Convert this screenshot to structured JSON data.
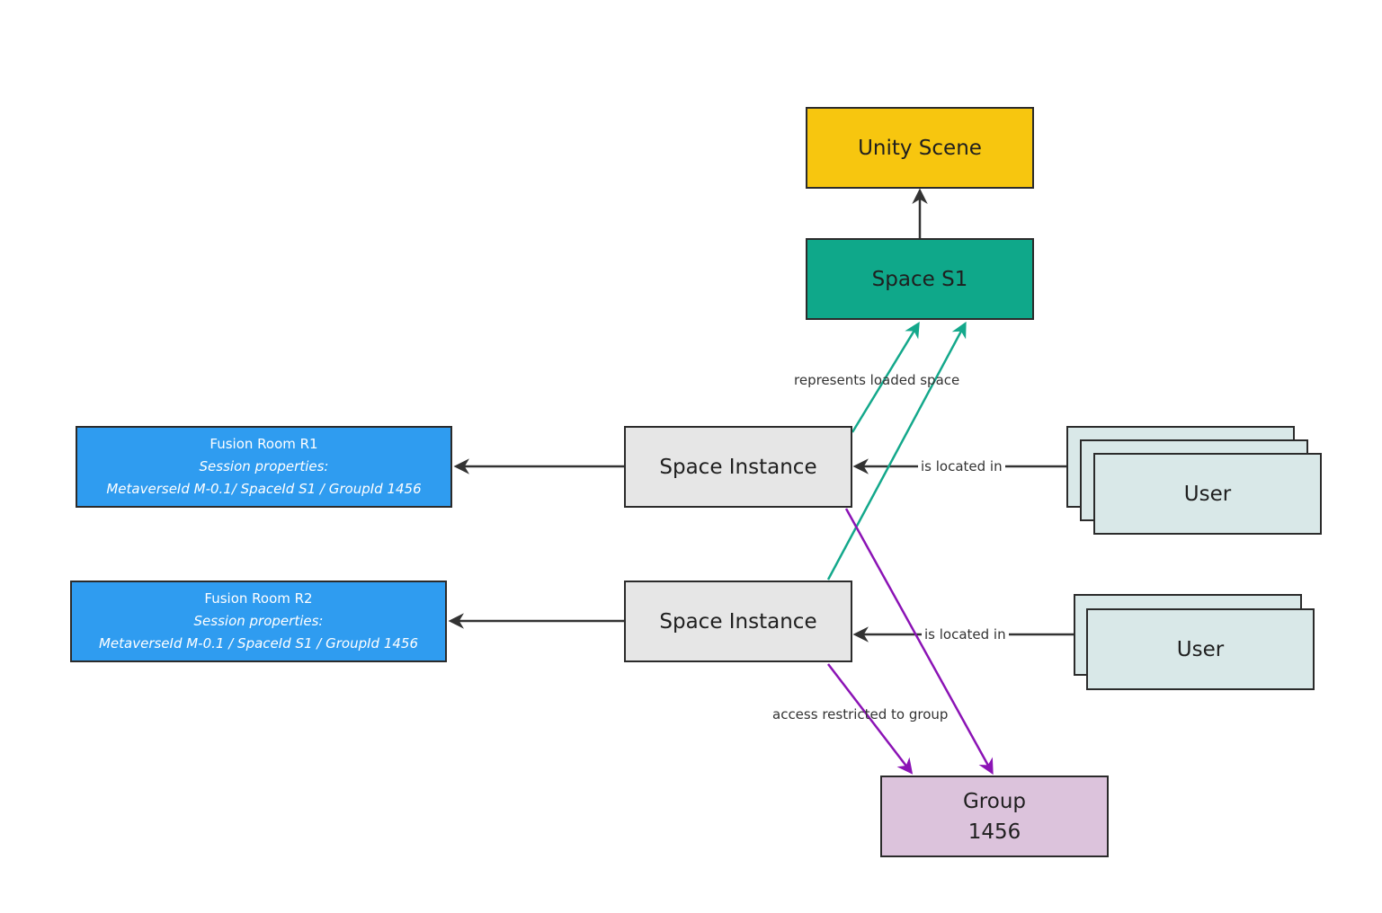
{
  "colors": {
    "unity_scene": "#f7c60f",
    "space": "#0fa88a",
    "fusion_room": "#2f9cf0",
    "space_instance": "#e6e6e6",
    "user": "#d9e8e8",
    "group": "#dcc3dc",
    "edge_dark": "#333333",
    "edge_teal": "#13a88b",
    "edge_purple": "#8b13b5"
  },
  "nodes": {
    "unity_scene": {
      "label": "Unity Scene"
    },
    "space_s1": {
      "label": "Space S1"
    },
    "space_instance_1": {
      "label": "Space Instance"
    },
    "space_instance_2": {
      "label": "Space Instance"
    },
    "fusion_room_r1": {
      "title": "Fusion Room R1",
      "subtitle": "Session properties:",
      "properties": "MetaverseId M-0.1/ SpaceId S1 / GroupId 1456"
    },
    "fusion_room_r2": {
      "title": "Fusion Room R2",
      "subtitle": "Session properties:",
      "properties": "MetaverseId M-0.1 / SpaceId S1 / GroupId 1456"
    },
    "user_stack_1": {
      "label": "User"
    },
    "user_stack_2": {
      "label": "User"
    },
    "group": {
      "line1": "Group",
      "line2": "1456"
    }
  },
  "edges": {
    "represents": {
      "label": "represents loaded space"
    },
    "located_1": {
      "label": "is located in"
    },
    "located_2": {
      "label": "is located in"
    },
    "access": {
      "label": "access restricted to group"
    }
  }
}
